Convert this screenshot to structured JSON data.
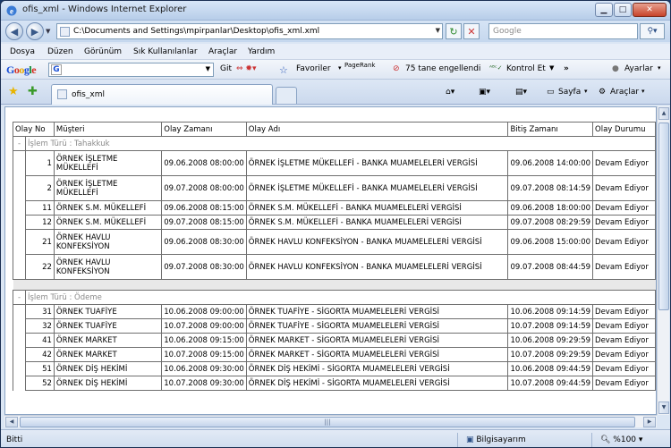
{
  "window": {
    "title": "ofis_xml - Windows Internet Explorer"
  },
  "address": {
    "url": "C:\\Documents and Settings\\mpirpanlar\\Desktop\\ofis_xml.xml",
    "search_placeholder": "Google"
  },
  "menu": [
    "Dosya",
    "Düzen",
    "Görünüm",
    "Sık Kullanılanlar",
    "Araçlar",
    "Yardım"
  ],
  "google_toolbar": {
    "logo": [
      "G",
      "o",
      "o",
      "g",
      "l",
      "e"
    ],
    "search_icon": "G",
    "git": "Git",
    "favoriler": "Favoriler",
    "pagerank": "PageRank",
    "blocked": "75 tane engellendi",
    "check": "Kontrol Et",
    "more": "»",
    "settings": "Ayarlar"
  },
  "tab": {
    "label": "ofis_xml"
  },
  "commands": {
    "page": "Sayfa",
    "tools": "Araçlar"
  },
  "table": {
    "headers": [
      "Olay No",
      "Müşteri",
      "Olay Zamanı",
      "Olay Adı",
      "Bitiş Zamanı",
      "Olay Durumu"
    ],
    "groups": [
      {
        "label": "İşlem Türü : Tahakkuk",
        "rows": [
          {
            "no": "1",
            "customer": "ÖRNEK İŞLETME MÜKELLEFİ",
            "start": "09.06.2008 08:00:00",
            "name": "ÖRNEK İŞLETME MÜKELLEFİ - BANKA MUAMELELERİ VERGİSİ",
            "end": "09.06.2008 14:00:00",
            "status": "Devam Ediyor",
            "tall": true
          },
          {
            "no": "2",
            "customer": "ÖRNEK İŞLETME MÜKELLEFİ",
            "start": "09.07.2008 08:00:00",
            "name": "ÖRNEK İŞLETME MÜKELLEFİ - BANKA MUAMELELERİ VERGİSİ",
            "end": "09.07.2008 08:14:59",
            "status": "Devam Ediyor",
            "tall": true
          },
          {
            "no": "11",
            "customer": "ÖRNEK S.M. MÜKELLEFİ",
            "start": "09.06.2008 08:15:00",
            "name": "ÖRNEK S.M. MÜKELLEFİ - BANKA MUAMELELERİ VERGİSİ",
            "end": "09.06.2008 18:00:00",
            "status": "Devam Ediyor",
            "tall": false
          },
          {
            "no": "12",
            "customer": "ÖRNEK S.M. MÜKELLEFİ",
            "start": "09.07.2008 08:15:00",
            "name": "ÖRNEK S.M. MÜKELLEFİ - BANKA MUAMELELERİ VERGİSİ",
            "end": "09.07.2008 08:29:59",
            "status": "Devam Ediyor",
            "tall": false
          },
          {
            "no": "21",
            "customer": "ÖRNEK HAVLU KONFEKSİYON",
            "start": "09.06.2008 08:30:00",
            "name": "ÖRNEK HAVLU KONFEKSİYON - BANKA MUAMELELERİ VERGİSİ",
            "end": "09.06.2008 15:00:00",
            "status": "Devam Ediyor",
            "tall": true
          },
          {
            "no": "22",
            "customer": "ÖRNEK HAVLU KONFEKSİYON",
            "start": "09.07.2008 08:30:00",
            "name": "ÖRNEK HAVLU KONFEKSİYON - BANKA MUAMELELERİ VERGİSİ",
            "end": "09.07.2008 08:44:59",
            "status": "Devam Ediyor",
            "tall": true
          }
        ]
      },
      {
        "label": "İşlem Türü : Ödeme",
        "rows": [
          {
            "no": "31",
            "customer": "ÖRNEK TUAFİYE",
            "start": "10.06.2008 09:00:00",
            "name": "ÖRNEK TUAFİYE - SİGORTA MUAMELELERİ VERGİSİ",
            "end": "10.06.2008 09:14:59",
            "status": "Devam Ediyor",
            "tall": false
          },
          {
            "no": "32",
            "customer": "ÖRNEK TUAFİYE",
            "start": "10.07.2008 09:00:00",
            "name": "ÖRNEK TUAFİYE - SİGORTA MUAMELELERİ VERGİSİ",
            "end": "10.07.2008 09:14:59",
            "status": "Devam Ediyor",
            "tall": false
          },
          {
            "no": "41",
            "customer": "ÖRNEK MARKET",
            "start": "10.06.2008 09:15:00",
            "name": "ÖRNEK MARKET - SİGORTA MUAMELELERİ VERGİSİ",
            "end": "10.06.2008 09:29:59",
            "status": "Devam Ediyor",
            "tall": false
          },
          {
            "no": "42",
            "customer": "ÖRNEK MARKET",
            "start": "10.07.2008 09:15:00",
            "name": "ÖRNEK MARKET - SİGORTA MUAMELELERİ VERGİSİ",
            "end": "10.07.2008 09:29:59",
            "status": "Devam Ediyor",
            "tall": false
          },
          {
            "no": "51",
            "customer": "ÖRNEK DİŞ HEKİMİ",
            "start": "10.06.2008 09:30:00",
            "name": "ÖRNEK DİŞ HEKİMİ - SİGORTA MUAMELELERİ VERGİSİ",
            "end": "10.06.2008 09:44:59",
            "status": "Devam Ediyor",
            "tall": false
          },
          {
            "no": "52",
            "customer": "ÖRNEK DİŞ HEKİMİ",
            "start": "10.07.2008 09:30:00",
            "name": "ÖRNEK DİŞ HEKİMİ - SİGORTA MUAMELELERİ VERGİSİ",
            "end": "10.07.2008 09:44:59",
            "status": "Devam Ediyor",
            "tall": false
          }
        ]
      }
    ]
  },
  "status": {
    "text": "Bitti",
    "zone": "Bilgisayarım",
    "zoom": "%100"
  }
}
